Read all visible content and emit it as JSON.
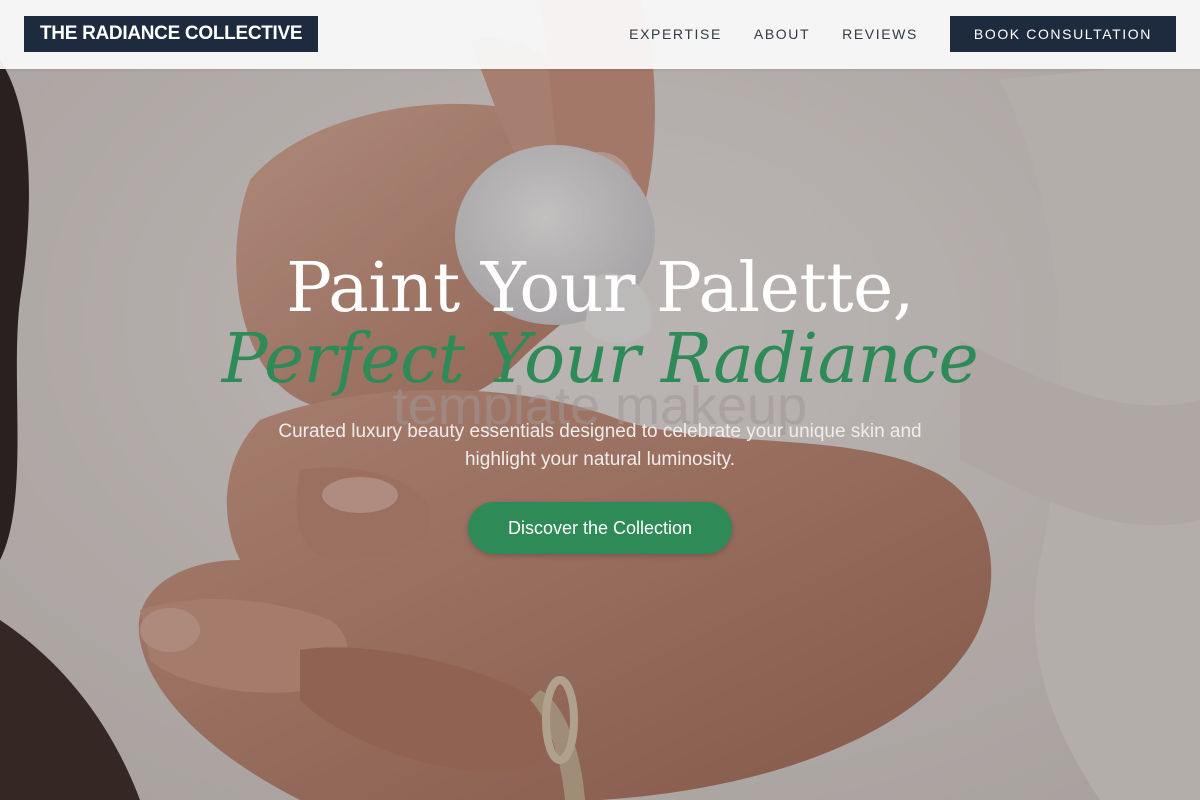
{
  "header": {
    "brand": "THE RADIANCE COLLECTIVE",
    "nav": [
      {
        "label": "EXPERTISE"
      },
      {
        "label": "ABOUT"
      },
      {
        "label": "REVIEWS"
      }
    ],
    "cta_label": "BOOK CONSULTATION"
  },
  "hero": {
    "title_line1": "Paint Your Palette,",
    "title_line2": "Perfect Your Radiance",
    "watermark": "template makeup",
    "subtitle": "Curated luxury beauty essentials designed to celebrate your unique skin and highlight your natural luminosity.",
    "cta_label": "Discover the Collection",
    "background_image": "hands-applying-cream-photo"
  },
  "colors": {
    "brand_navy": "#1e2a3d",
    "accent_green": "#2e8b57",
    "header_bg": "#fafafa"
  }
}
